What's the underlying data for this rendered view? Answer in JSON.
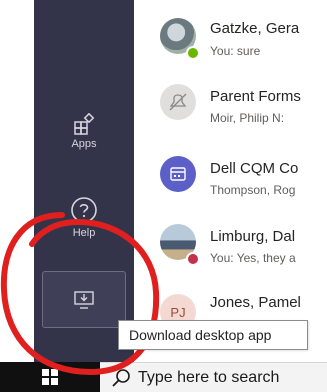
{
  "rail": {
    "apps_label": "Apps",
    "help_label": "Help",
    "download_tooltip": "Download desktop app"
  },
  "chats": [
    {
      "name": "Gatzke, Gera",
      "preview": "You: sure",
      "avatar": "photo",
      "status": "available",
      "status_color": "#6bb700"
    },
    {
      "name": "Parent Forms",
      "preview": "Moir, Philip N:",
      "avatar": "muted-icon",
      "status": "none"
    },
    {
      "name": "Dell CQM Co",
      "preview": "Thompson, Rog",
      "avatar": "calendar-icon",
      "status": "none",
      "avatar_color": "#5b5fc7"
    },
    {
      "name": "Limburg, Dal",
      "preview": "You: Yes, they a",
      "avatar": "photo",
      "status": "busy",
      "status_color": "#c4314b"
    },
    {
      "name": "Jones, Pamel",
      "preview": "",
      "avatar_initials": "PJ",
      "avatar": "initials"
    }
  ],
  "taskbar": {
    "search_placeholder": "Type here to search"
  },
  "colors": {
    "rail_bg": "#33344a",
    "annotation": "#e0201e"
  }
}
